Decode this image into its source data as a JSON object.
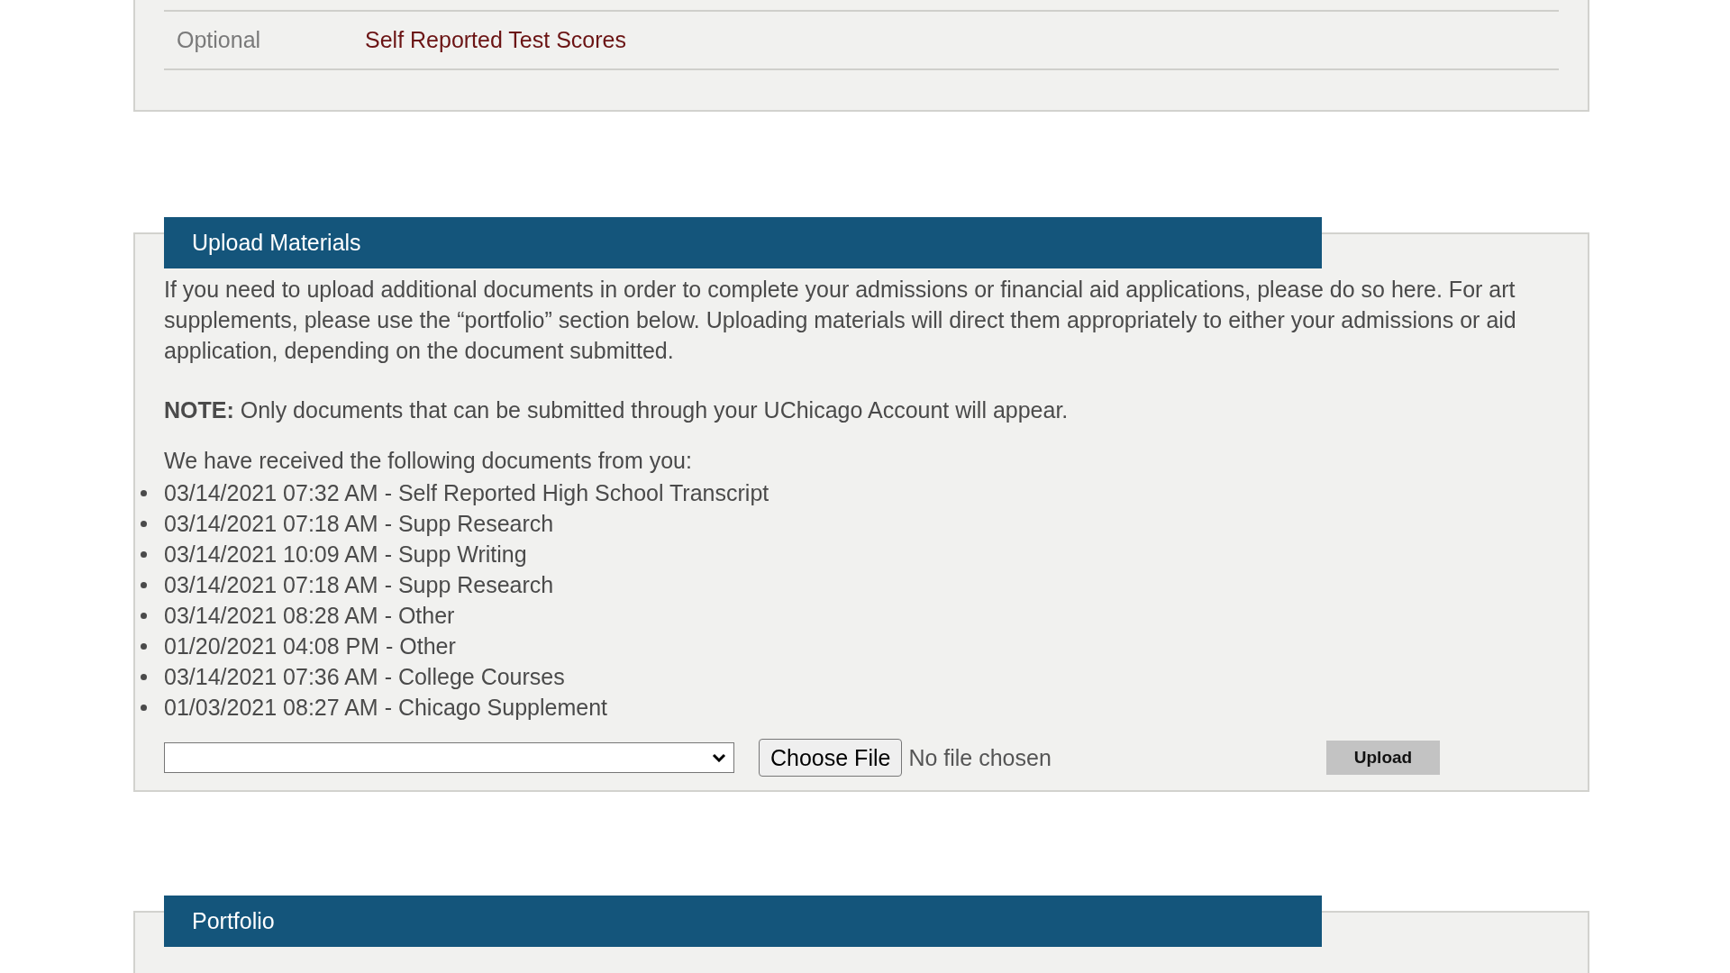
{
  "test_scores": {
    "rows": [
      {
        "status": "Optional",
        "link": "Self Reported Test Scores"
      }
    ]
  },
  "upload": {
    "title": "Upload Materials",
    "intro": "If you need to upload additional documents in order to complete your admissions or financial aid applications, please do so here.  For art supplements, please use the “portfolio” section below. Uploading materials will direct them appropriately to either your admissions or aid application, depending on the document submitted.",
    "note": "**NOTE:** Only documents that can be submitted through your UChicago Account will appear.",
    "received_label": "We have received the following documents from you:",
    "documents": [
      "03/14/2021 07:32 AM - Self Reported High School Transcript",
      "03/14/2021 07:18 AM - Supp Research",
      "03/14/2021 10:09 AM - Supp Writing",
      "03/14/2021 07:18 AM - Supp Research",
      "03/14/2021 08:28 AM - Other",
      "01/20/2021 04:08 PM - Other",
      "03/14/2021 07:36 AM - College Courses",
      "01/03/2021 08:27 AM - Chicago Supplement"
    ],
    "choose_file": "Choose File",
    "file_status": "No file chosen",
    "upload_button": "Upload"
  },
  "portfolio": {
    "title": "Portfolio"
  }
}
